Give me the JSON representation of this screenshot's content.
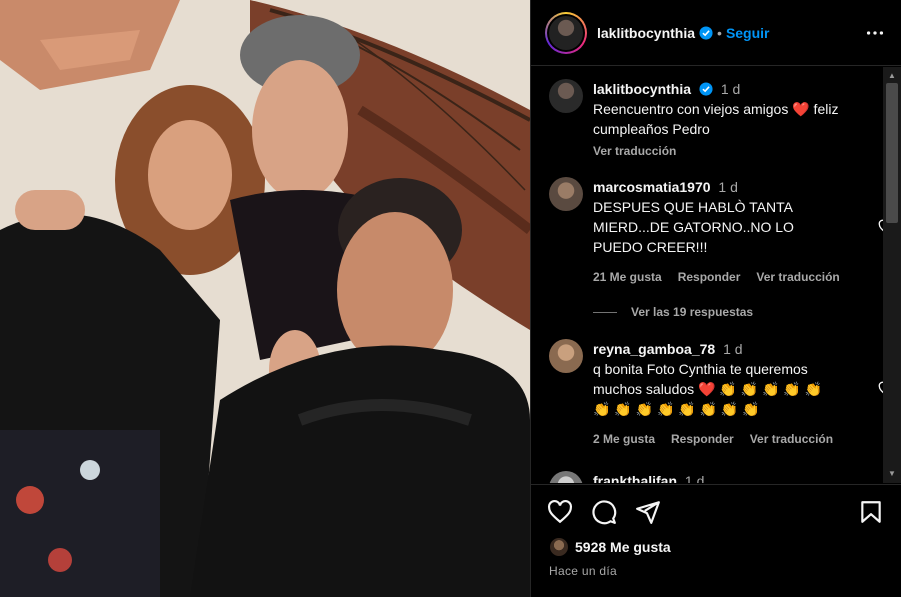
{
  "header": {
    "username": "laklitbocynthia",
    "separator": "•",
    "follow_label": "Seguir"
  },
  "caption": {
    "username": "laklitbocynthia",
    "time": "1 d",
    "text_part1": "Reencuentro con viejos amigos",
    "emoji": "❤️",
    "text_part2": " feliz cumpleaños Pedro",
    "translate_label": "Ver traducción"
  },
  "comments": [
    {
      "username": "marcosmatia1970",
      "time": "1 d",
      "text": "DESPUES QUE HABLÒ TANTA MIERD...DE GATORNO..NO LO PUEDO CREER!!!",
      "likes": "21 Me gusta",
      "reply_label": "Responder",
      "translate_label": "Ver traducción",
      "view_replies": "Ver las 19 respuestas"
    },
    {
      "username": "reyna_gamboa_78",
      "time": "1 d",
      "text": "q bonita Foto Cynthia te queremos muchos saludos ❤️ 👏 👏 👏 👏 👏 👏 👏 👏 👏 👏 👏 👏 👏",
      "likes": "2 Me gusta",
      "reply_label": "Responder",
      "translate_label": "Ver traducción"
    },
    {
      "username": "frankthalifan",
      "time": "1 d"
    }
  ],
  "footer": {
    "likes": "5928 Me gusta",
    "time_ago": "Hace un día"
  },
  "colors": {
    "accent": "#0095f6",
    "heart": "#ff3040",
    "muted": "#a8a8a8",
    "background": "#000000"
  },
  "icons": [
    "verified-icon",
    "more-options-icon",
    "heart-icon",
    "comment-icon",
    "share-icon",
    "bookmark-icon"
  ]
}
